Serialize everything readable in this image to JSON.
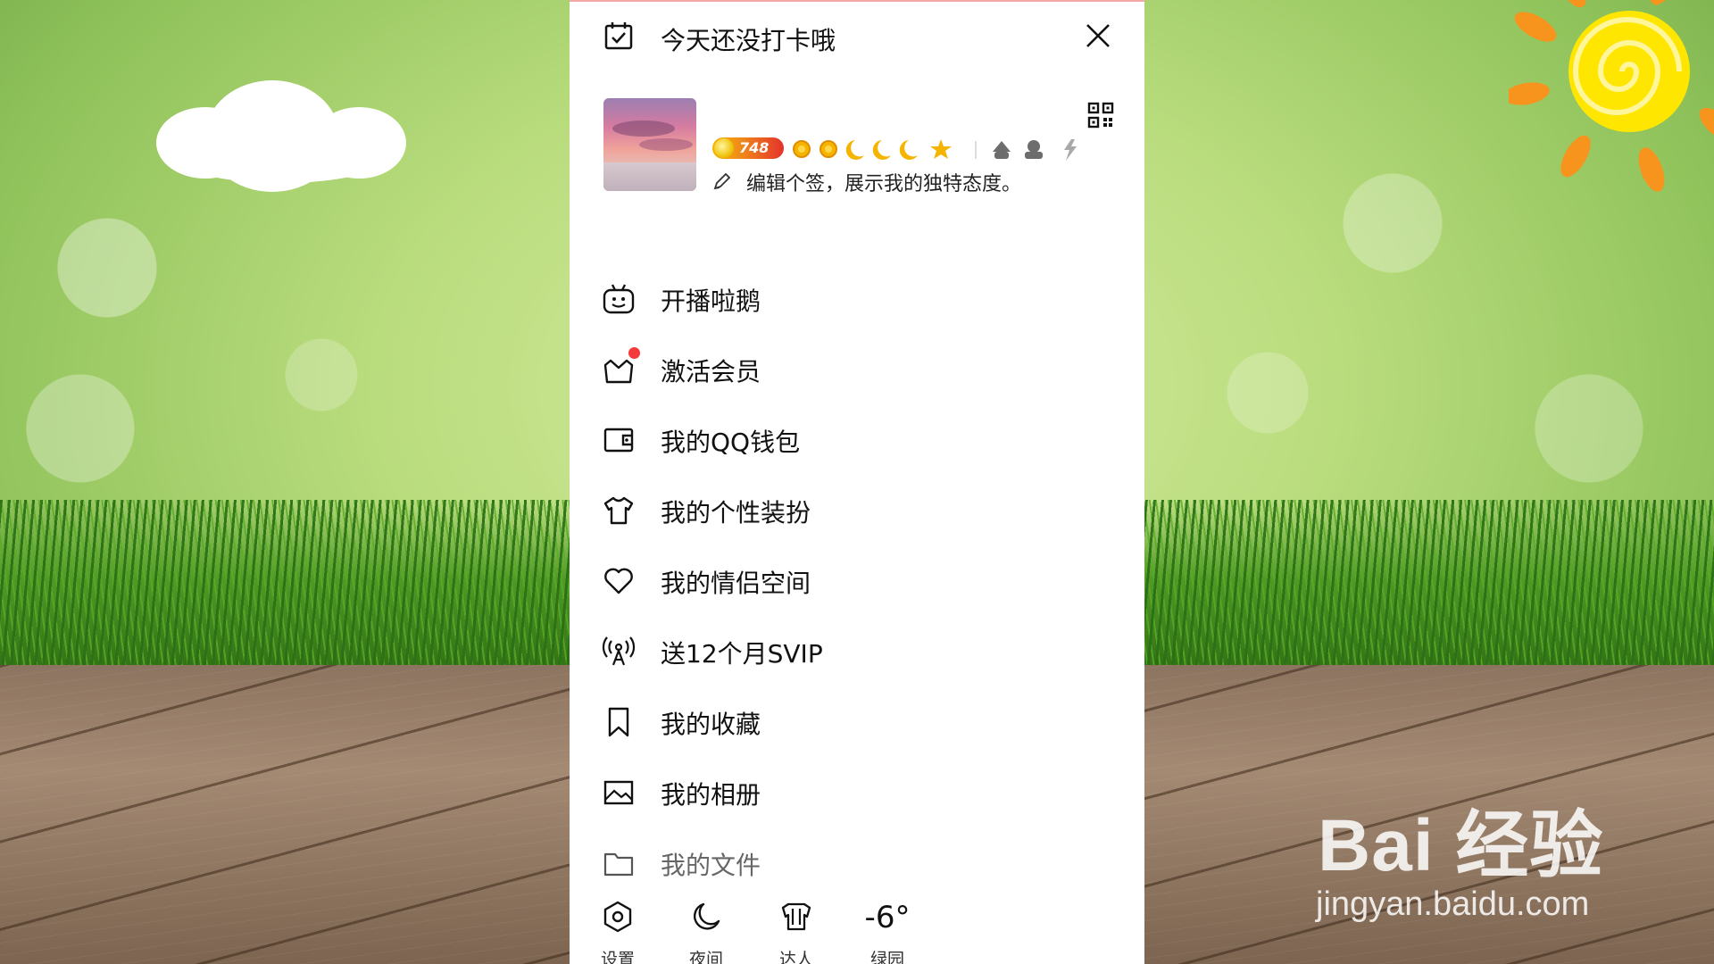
{
  "panel": {
    "checkin_label": "今天还没打卡哦",
    "level": "748",
    "signature_placeholder": "编辑个签，展示我的独特态度。"
  },
  "menu": [
    {
      "label": "开播啦鹅",
      "icon": "penguin-live-icon"
    },
    {
      "label": "激活会员",
      "icon": "crown-icon",
      "badge": "red-dot"
    },
    {
      "label": "我的QQ钱包",
      "icon": "wallet-icon"
    },
    {
      "label": "我的个性装扮",
      "icon": "tshirt-icon"
    },
    {
      "label": "我的情侣空间",
      "icon": "heart-icon"
    },
    {
      "label": "送12个月SVIP",
      "icon": "broadcast-icon"
    },
    {
      "label": "我的收藏",
      "icon": "bookmark-icon"
    },
    {
      "label": "我的相册",
      "icon": "album-icon"
    },
    {
      "label": "我的文件",
      "icon": "folder-icon"
    }
  ],
  "bottom": {
    "settings_label": "设置",
    "night_label": "夜间",
    "expert_label": "达人",
    "weather_temp": "-6°",
    "weather_place": "绿园"
  },
  "watermark": {
    "brand": "Bai 经验",
    "url": "jingyan.baidu.com"
  },
  "colors": {
    "accent_red": "#f43a3a",
    "level_gradient_start": "#f6b400",
    "level_gradient_end": "#e4322b",
    "sun_orange": "#f7941d",
    "sun_yellow": "#ffe600"
  }
}
